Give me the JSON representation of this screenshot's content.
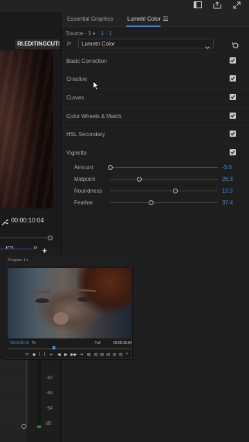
{
  "top_bar": {
    "icons": [
      "panel-layout-icon",
      "share-export-icon",
      "expand-icon"
    ]
  },
  "source_monitor": {
    "watermark": "RI.EDITINGCUTS",
    "timecode": "00:00:10:04",
    "icons": [
      "wrench-icon",
      "export-frame-icon",
      "chevrons-right-icon",
      "add-icon"
    ]
  },
  "panel": {
    "tabs": [
      {
        "label": "Essential Graphics",
        "active": false
      },
      {
        "label": "Lumetri Color",
        "active": true
      }
    ],
    "source_label": "Source · 1",
    "source_caret": "▾",
    "sequence_link": "1 · 1",
    "fx_label": "fx",
    "effect_name": "Lumetri Color",
    "sections": [
      {
        "label": "Basic Correction",
        "enabled": true
      },
      {
        "label": "Creative",
        "enabled": true
      },
      {
        "label": "Curves",
        "enabled": true
      },
      {
        "label": "Color Wheels & Match",
        "enabled": true
      },
      {
        "label": "HSL Secondary",
        "enabled": true
      },
      {
        "label": "Vignette",
        "enabled": true
      }
    ],
    "vignette_params": [
      {
        "label": "Amount",
        "value": "-3.0",
        "slider_fraction": 0.0
      },
      {
        "label": "Midpoint",
        "value": "26.3",
        "slider_fraction": 0.27
      },
      {
        "label": "Roundness",
        "value": "19.3",
        "slider_fraction": 0.6
      },
      {
        "label": "Feather",
        "value": "37.4",
        "slider_fraction": 0.38
      }
    ]
  },
  "program_monitor": {
    "title": "Program: 1 ≡",
    "timecode_current": "00:00:00:18",
    "fit": "Fit",
    "quality": "Full",
    "timecode_duration": "00:00:10:04",
    "controls": [
      "⊓",
      "◆",
      "|",
      "|",
      "⇤",
      "◀",
      "▶",
      "▶▶",
      "⇥",
      "⊞",
      "⊟",
      "⊟",
      "⊟",
      "⊟",
      "⊟",
      "+"
    ]
  },
  "audio_meter": {
    "db_labels": [
      "-42",
      "-48",
      "-54",
      "dB"
    ]
  },
  "colors": {
    "accent_blue": "#3f8fe8",
    "panel_bg": "#1e1e1e",
    "meter_green": "#2e8b2e"
  }
}
